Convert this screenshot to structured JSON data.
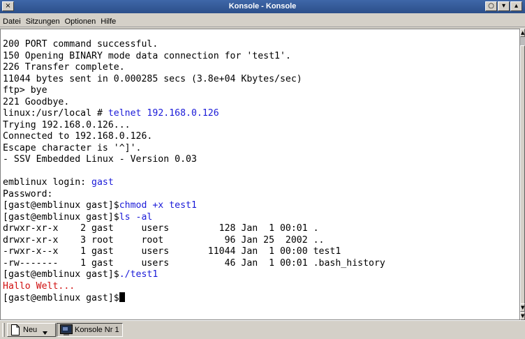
{
  "window": {
    "title": "Konsole - Konsole",
    "close_glyph": "×",
    "titlebar_buttons": [
      "○",
      "▾",
      "▴"
    ]
  },
  "menubar": {
    "items": [
      "Datei",
      "Sitzungen",
      "Optionen",
      "Hilfe"
    ]
  },
  "terminal": {
    "lines": [
      "200 PORT command successful.",
      "150 Opening BINARY mode data connection for 'test1'.",
      "226 Transfer complete.",
      "11044 bytes sent in 0.000285 secs (3.8e+04 Kbytes/sec)",
      "ftp> bye",
      "221 Goodbye.",
      "linux:/usr/local # ",
      "Trying 192.168.0.126...",
      "Connected to 192.168.0.126.",
      "Escape character is '^]'.",
      "- SSV Embedded Linux - Version 0.03",
      "",
      "emblinux login: ",
      "Password:",
      "[gast@emblinux gast]$",
      "[gast@emblinux gast]$",
      "drwxr-xr-x    2 gast     users         128 Jan  1 00:01 .",
      "drwxr-xr-x    3 root     root           96 Jan 25  2002 ..",
      "-rwxr-x--x    1 gast     users       11044 Jan  1 00:00 test1",
      "-rw-------    1 gast     users          46 Jan  1 00:01 .bash_history",
      "[gast@emblinux gast]$",
      "Hallo Welt...",
      "[gast@emblinux gast]$"
    ],
    "typed": {
      "telnet_cmd": "telnet 192.168.0.126",
      "login_user": "gast",
      "chmod_cmd": "chmod +x test1",
      "ls_cmd": "ls -al",
      "run_cmd": "./test1"
    },
    "colors": {
      "background": "#ffffff",
      "text": "#000000",
      "input": "#1a1ad8",
      "program_output": "#d01010"
    }
  },
  "taskbar": {
    "new_label": "Neu",
    "session_label": "Konsole Nr 1"
  }
}
